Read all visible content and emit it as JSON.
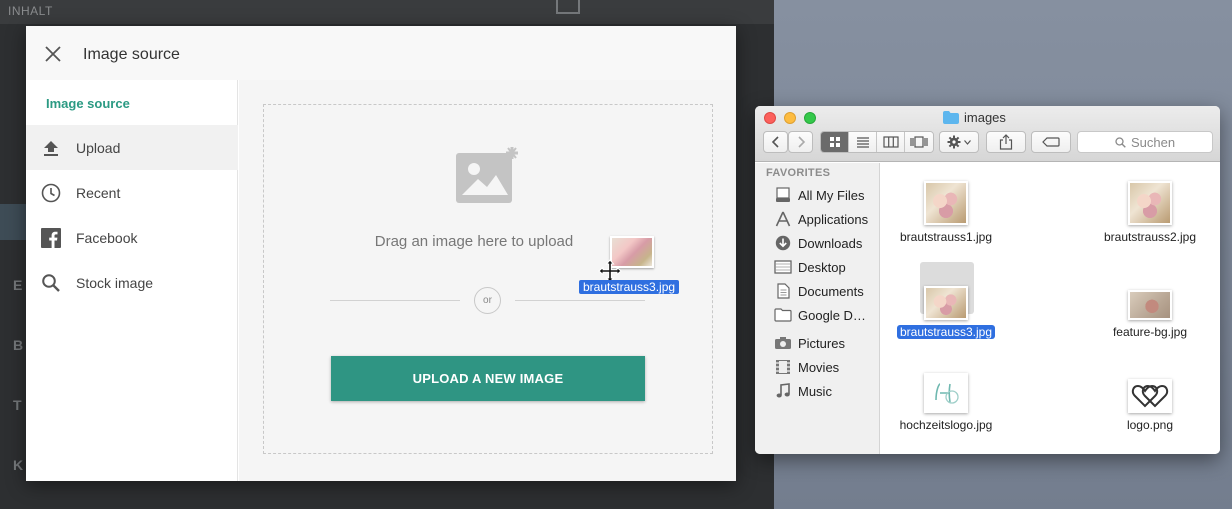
{
  "background_app": {
    "header_label": "INHALT",
    "letters": [
      "E",
      "B",
      "T",
      "K"
    ]
  },
  "dialog": {
    "title": "Image source",
    "sidebar": {
      "heading": "Image source",
      "items": [
        {
          "label": "Upload",
          "icon": "upload-icon",
          "active": true
        },
        {
          "label": "Recent",
          "icon": "clock-icon",
          "active": false
        },
        {
          "label": "Facebook",
          "icon": "facebook-icon",
          "active": false
        },
        {
          "label": "Stock image",
          "icon": "search-icon",
          "active": false
        }
      ]
    },
    "dropzone": {
      "text": "Drag an image here to upload",
      "or_label": "or",
      "button_label": "UPLOAD A NEW IMAGE"
    },
    "accent_color": "#2f9583"
  },
  "drag": {
    "filename": "brautstrauss3.jpg"
  },
  "finder": {
    "title": "images",
    "search_placeholder": "Suchen",
    "favorites_heading": "FAVORITES",
    "favorites": [
      {
        "label": "All My Files",
        "icon": "all-files-icon"
      },
      {
        "label": "Applications",
        "icon": "applications-icon"
      },
      {
        "label": "Downloads",
        "icon": "downloads-icon"
      },
      {
        "label": "Desktop",
        "icon": "desktop-icon"
      },
      {
        "label": "Documents",
        "icon": "documents-icon"
      },
      {
        "label": "Google D…",
        "icon": "folder-icon"
      },
      {
        "label": "Pictures",
        "icon": "camera-icon"
      },
      {
        "label": "Movies",
        "icon": "film-icon"
      },
      {
        "label": "Music",
        "icon": "music-note-icon"
      }
    ],
    "files": [
      {
        "name": "brautstrauss1.jpg",
        "selected": false
      },
      {
        "name": "brautstrauss2.jpg",
        "selected": false
      },
      {
        "name": "brautstrauss3.jpg",
        "selected": true
      },
      {
        "name": "feature-bg.jpg",
        "selected": false
      },
      {
        "name": "hochzeitslogo.jpg",
        "selected": false
      },
      {
        "name": "logo.png",
        "selected": false
      }
    ],
    "selection_color": "#2f6fe0"
  }
}
